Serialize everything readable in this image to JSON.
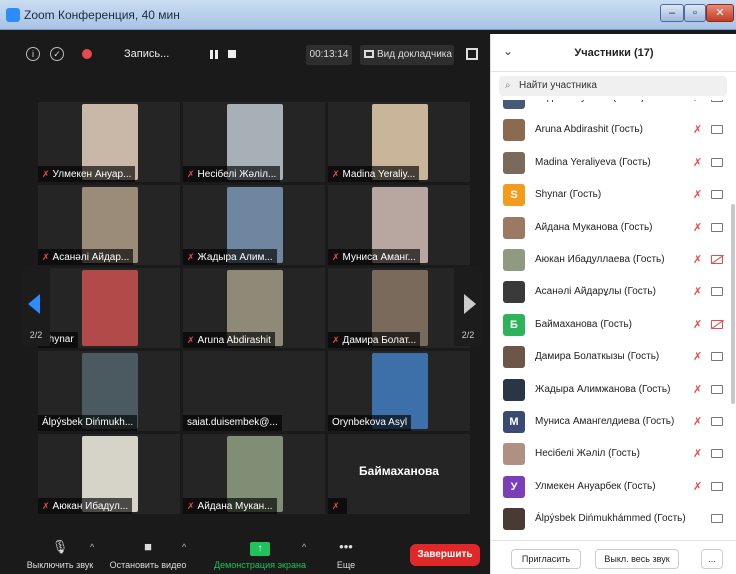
{
  "window": {
    "title": "Zoom Конференция, 40 мин",
    "controls": [
      "–",
      "▫",
      "✕"
    ]
  },
  "topbar": {
    "recording_label": "Запись...",
    "timer": "00:13:14",
    "view_label": "Вид докладчика"
  },
  "colors": {
    "accent": "#2d8cff",
    "end": "#e02828",
    "share": "#1fc25b",
    "muted": "#e8494f"
  },
  "grid": {
    "tiles": [
      {
        "name": "Улмекен Ануар...",
        "muted": true,
        "photo": "#c9b8a8"
      },
      {
        "name": "Несібелі Жәліл...",
        "muted": true,
        "photo": "#a7b0b7"
      },
      {
        "name": "Madina Yeraliy...",
        "muted": true,
        "photo": "#c8b59a"
      },
      {
        "name": "Асанәлі Айдар...",
        "muted": true,
        "photo": "#9a8c79"
      },
      {
        "name": "Жадыра Алим...",
        "muted": true,
        "photo": "#6f86a0"
      },
      {
        "name": "Муниса Аманг...",
        "muted": true,
        "photo": "#b7a7a0"
      },
      {
        "name": "Shynar",
        "muted": false,
        "photo": "#b34a4a"
      },
      {
        "name": "Aruna Abdirashit",
        "muted": true,
        "photo": "#8f8a78"
      },
      {
        "name": "Дамира Болат...",
        "muted": true,
        "photo": "#7a6a5c"
      },
      {
        "name": "Álpýsbek Dińmukh...",
        "muted": false,
        "photo": "#4a5a60"
      },
      {
        "name": "saiat.duisembek@...",
        "muted": false,
        "photo": ""
      },
      {
        "name": "Orynbekova Asyl",
        "muted": false,
        "photo": "#3d6fa8"
      },
      {
        "name": "Аюкан Ибадул...",
        "muted": true,
        "photo": "#d6d3c8"
      },
      {
        "name": "Айдана Мукан...",
        "muted": true,
        "photo": "#7f8e74"
      },
      {
        "name": "",
        "muted": true,
        "big_name": "Баймаханова",
        "photo": ""
      }
    ],
    "page_left": "2/2",
    "page_right": "2/2"
  },
  "toolbar": {
    "mute": {
      "label": "Выключить звук",
      "icon": "microphone-icon"
    },
    "video": {
      "label": "Остановить видео",
      "icon": "camera-icon"
    },
    "share": {
      "label": "Демонстрация экрана",
      "icon": "share-screen-icon"
    },
    "more": {
      "label": "Еще",
      "icon": "more-dots-icon"
    },
    "end_label": "Завершить"
  },
  "panel": {
    "title": "Участники (17)",
    "search_placeholder": "Найти участника",
    "participants": [
      {
        "name": "Айдана Мукан... (Гость)",
        "avatar_letter": "",
        "avatar_color": "#445a75",
        "cam_off": false
      },
      {
        "name": "Aruna Abdirashit (Гость)",
        "avatar_letter": "",
        "avatar_color": "#8a6b52",
        "cam_off": false
      },
      {
        "name": "Madina Yeraliyeva (Гость)",
        "avatar_letter": "",
        "avatar_color": "#7a6a5a",
        "cam_off": false
      },
      {
        "name": "Shynar (Гость)",
        "avatar_letter": "S",
        "avatar_color": "#f29b1d",
        "cam_off": false
      },
      {
        "name": "Айдана Муканова (Гость)",
        "avatar_letter": "",
        "avatar_color": "#9a7a62",
        "cam_off": false
      },
      {
        "name": "Аюкан Ибадуллаева (Гость)",
        "avatar_letter": "",
        "avatar_color": "#8f9a80",
        "cam_off": true
      },
      {
        "name": "Асанәлі Айдарұлы (Гость)",
        "avatar_letter": "",
        "avatar_color": "#3a3a3a",
        "cam_off": false
      },
      {
        "name": "Баймаханова (Гость)",
        "avatar_letter": "Б",
        "avatar_color": "#2fb35a",
        "cam_off": true
      },
      {
        "name": "Дамира Болаткызы (Гость)",
        "avatar_letter": "",
        "avatar_color": "#6c5648",
        "cam_off": false
      },
      {
        "name": "Жадыра Алимжанова (Гость)",
        "avatar_letter": "",
        "avatar_color": "#2a3545",
        "cam_off": false
      },
      {
        "name": "Муниса Амангелдиева (Гость)",
        "avatar_letter": "М",
        "avatar_color": "#3a4a70",
        "cam_off": false
      },
      {
        "name": "Несібелі Жәліл (Гость)",
        "avatar_letter": "",
        "avatar_color": "#b09080",
        "cam_off": false
      },
      {
        "name": "Улмекен Ануарбек (Гость)",
        "avatar_letter": "У",
        "avatar_color": "#7a3fb8",
        "cam_off": false
      },
      {
        "name": "Álpýsbek Dińmukhámmed (Гость)",
        "avatar_letter": "",
        "avatar_color": "#4a3a34",
        "cam_off": false
      }
    ],
    "invite_label": "Пригласить",
    "mute_all_label": "Выкл. весь звук",
    "more_label": "..."
  }
}
